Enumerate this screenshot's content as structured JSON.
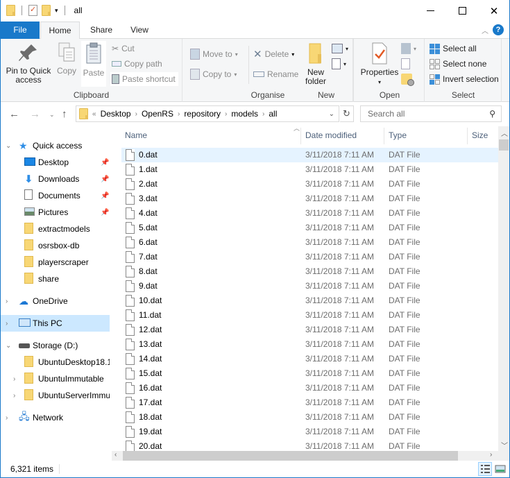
{
  "window": {
    "title": "all",
    "controls": {
      "minimize": "—",
      "maximize": "☐",
      "close": "✕"
    }
  },
  "ribbon_tabs": [
    {
      "label": "File"
    },
    {
      "label": "Home"
    },
    {
      "label": "Share"
    },
    {
      "label": "View"
    }
  ],
  "ribbon": {
    "clipboard": {
      "label": "Clipboard",
      "pin": "Pin to Quick access",
      "pin_l1": "Pin to Quick",
      "pin_l2": "access",
      "copy": "Copy",
      "paste": "Paste",
      "cut": "Cut",
      "copy_path": "Copy path",
      "paste_shortcut": "Paste shortcut"
    },
    "organise": {
      "label": "Organise",
      "move_to": "Move to",
      "copy_to": "Copy to",
      "delete": "Delete",
      "rename": "Rename"
    },
    "new": {
      "label": "New",
      "new_folder_l1": "New",
      "new_folder_l2": "folder"
    },
    "open": {
      "label": "Open",
      "properties": "Properties"
    },
    "select": {
      "label": "Select",
      "select_all": "Select all",
      "select_none": "Select none",
      "invert_selection": "Invert selection"
    }
  },
  "address": {
    "overflow": "«",
    "crumbs": [
      "Desktop",
      "OpenRS",
      "repository",
      "models",
      "all"
    ]
  },
  "search": {
    "placeholder": "Search all"
  },
  "sidebar": {
    "items": [
      {
        "label": "Quick access",
        "icon": "star"
      },
      {
        "label": "Desktop",
        "icon": "desktop",
        "pinned": true
      },
      {
        "label": "Downloads",
        "icon": "download",
        "pinned": true
      },
      {
        "label": "Documents",
        "icon": "document",
        "pinned": true
      },
      {
        "label": "Pictures",
        "icon": "picture",
        "pinned": true
      },
      {
        "label": "extractmodels",
        "icon": "folder"
      },
      {
        "label": "osrsbox-db",
        "icon": "folder"
      },
      {
        "label": "playerscraper",
        "icon": "folder"
      },
      {
        "label": "share",
        "icon": "folder"
      },
      {
        "label": "OneDrive",
        "icon": "cloud"
      },
      {
        "label": "This PC",
        "icon": "computer",
        "selected": true
      },
      {
        "label": "Storage (D:)",
        "icon": "drive"
      },
      {
        "label": "UbuntuDesktop18.1",
        "icon": "folder"
      },
      {
        "label": "UbuntuImmutable",
        "icon": "folder"
      },
      {
        "label": "UbuntuServerImmu",
        "icon": "folder"
      },
      {
        "label": "Network",
        "icon": "network"
      }
    ]
  },
  "columns": [
    "Name",
    "Date modified",
    "Type",
    "Size"
  ],
  "files": [
    {
      "name": "0.dat",
      "date": "3/11/2018 7:11 AM",
      "type": "DAT File"
    },
    {
      "name": "1.dat",
      "date": "3/11/2018 7:11 AM",
      "type": "DAT File"
    },
    {
      "name": "2.dat",
      "date": "3/11/2018 7:11 AM",
      "type": "DAT File"
    },
    {
      "name": "3.dat",
      "date": "3/11/2018 7:11 AM",
      "type": "DAT File"
    },
    {
      "name": "4.dat",
      "date": "3/11/2018 7:11 AM",
      "type": "DAT File"
    },
    {
      "name": "5.dat",
      "date": "3/11/2018 7:11 AM",
      "type": "DAT File"
    },
    {
      "name": "6.dat",
      "date": "3/11/2018 7:11 AM",
      "type": "DAT File"
    },
    {
      "name": "7.dat",
      "date": "3/11/2018 7:11 AM",
      "type": "DAT File"
    },
    {
      "name": "8.dat",
      "date": "3/11/2018 7:11 AM",
      "type": "DAT File"
    },
    {
      "name": "9.dat",
      "date": "3/11/2018 7:11 AM",
      "type": "DAT File"
    },
    {
      "name": "10.dat",
      "date": "3/11/2018 7:11 AM",
      "type": "DAT File"
    },
    {
      "name": "11.dat",
      "date": "3/11/2018 7:11 AM",
      "type": "DAT File"
    },
    {
      "name": "12.dat",
      "date": "3/11/2018 7:11 AM",
      "type": "DAT File"
    },
    {
      "name": "13.dat",
      "date": "3/11/2018 7:11 AM",
      "type": "DAT File"
    },
    {
      "name": "14.dat",
      "date": "3/11/2018 7:11 AM",
      "type": "DAT File"
    },
    {
      "name": "15.dat",
      "date": "3/11/2018 7:11 AM",
      "type": "DAT File"
    },
    {
      "name": "16.dat",
      "date": "3/11/2018 7:11 AM",
      "type": "DAT File"
    },
    {
      "name": "17.dat",
      "date": "3/11/2018 7:11 AM",
      "type": "DAT File"
    },
    {
      "name": "18.dat",
      "date": "3/11/2018 7:11 AM",
      "type": "DAT File"
    },
    {
      "name": "19.dat",
      "date": "3/11/2018 7:11 AM",
      "type": "DAT File"
    },
    {
      "name": "20.dat",
      "date": "3/11/2018 7:11 AM",
      "type": "DAT File"
    }
  ],
  "status": {
    "item_count": "6,321 items"
  },
  "colors": {
    "accent": "#1979ca",
    "selection": "#cce8ff",
    "hover": "#e5f3ff"
  }
}
